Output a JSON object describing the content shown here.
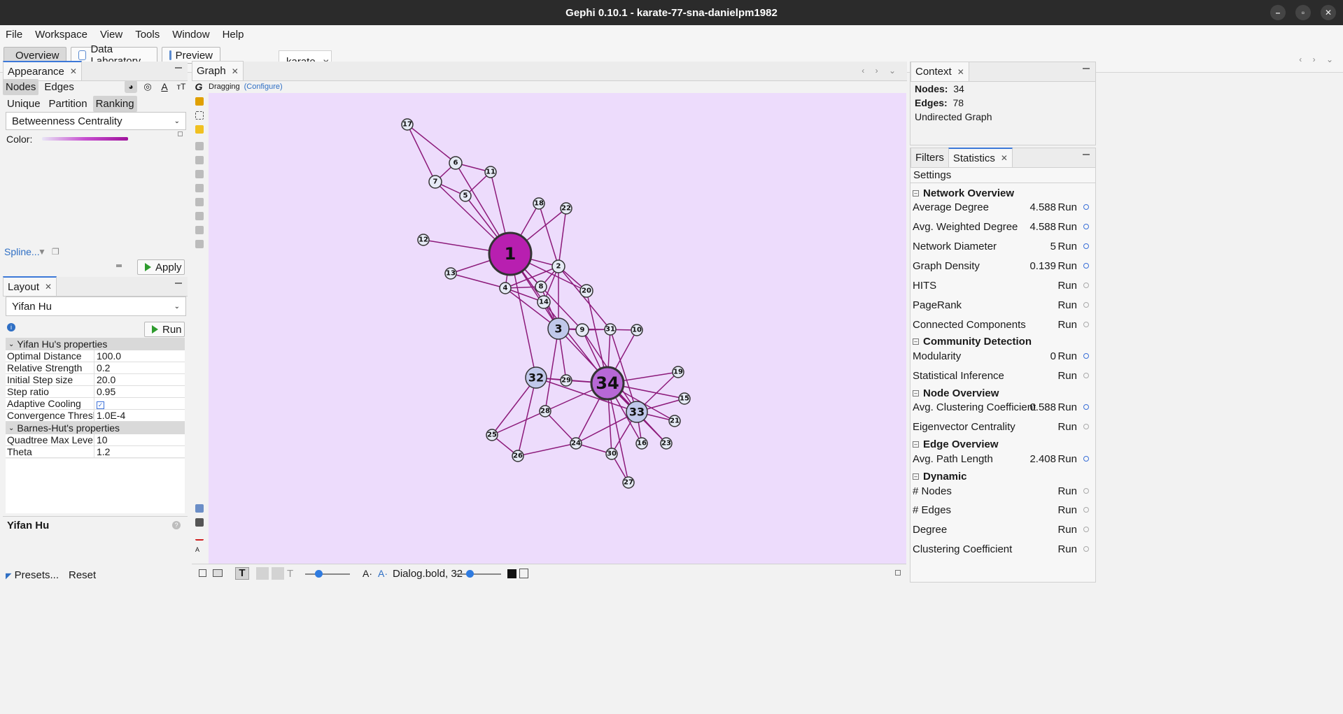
{
  "window": {
    "title": "Gephi 0.10.1 - karate-77-sna-danielpm1982"
  },
  "menu": [
    "File",
    "Workspace",
    "View",
    "Tools",
    "Window",
    "Help"
  ],
  "toolbar": {
    "overview": "Overview",
    "data_lab": "Data Laboratory",
    "preview": "Preview",
    "workspace_tab": "karate"
  },
  "appearance": {
    "tab": "Appearance",
    "nodes": "Nodes",
    "edges": "Edges",
    "unique": "Unique",
    "partition": "Partition",
    "ranking": "Ranking",
    "attribute": "Betweenness Centrality",
    "color_label": "Color:",
    "spline": "Spline...",
    "apply": "Apply"
  },
  "layout": {
    "tab": "Layout",
    "algorithm": "Yifan Hu",
    "run": "Run",
    "section1": "Yifan Hu's properties",
    "props1": [
      {
        "k": "Optimal Distance",
        "v": "100.0"
      },
      {
        "k": "Relative Strength",
        "v": "0.2"
      },
      {
        "k": "Initial Step size",
        "v": "20.0"
      },
      {
        "k": "Step ratio",
        "v": "0.95"
      },
      {
        "k": "Adaptive Cooling",
        "v": ""
      },
      {
        "k": "Convergence Threshold",
        "v": "1.0E-4"
      }
    ],
    "section2": "Barnes-Hut's properties",
    "props2": [
      {
        "k": "Quadtree Max Level",
        "v": "10"
      },
      {
        "k": "Theta",
        "v": "1.2"
      }
    ],
    "description_title": "Yifan Hu",
    "presets": "Presets...",
    "reset": "Reset"
  },
  "graph": {
    "tab": "Graph",
    "mode": "Dragging",
    "configure": "(Configure)",
    "font_label": "Dialog.bold, 32",
    "node_color": "#b01fa8",
    "edge_color": "#8c1a7a",
    "background": "#eddcfc"
  },
  "context": {
    "tab": "Context",
    "nodes_label": "Nodes:",
    "nodes_value": "34",
    "edges_label": "Edges:",
    "edges_value": "78",
    "type": "Undirected Graph"
  },
  "stats_panel": {
    "filters_tab": "Filters",
    "statistics_tab": "Statistics",
    "settings": "Settings",
    "sections": {
      "network": "Network Overview",
      "community": "Community Detection",
      "node": "Node Overview",
      "edge": "Edge Overview",
      "dynamic": "Dynamic"
    },
    "run_label": "Run",
    "rows": {
      "avg_degree": {
        "name": "Average Degree",
        "value": "4.588"
      },
      "avg_weighted": {
        "name": "Avg. Weighted Degree",
        "value": "4.588"
      },
      "diameter": {
        "name": "Network Diameter",
        "value": "5"
      },
      "density": {
        "name": "Graph Density",
        "value": "0.139"
      },
      "hits": {
        "name": "HITS",
        "value": ""
      },
      "pagerank": {
        "name": "PageRank",
        "value": ""
      },
      "components": {
        "name": "Connected Components",
        "value": ""
      },
      "modularity": {
        "name": "Modularity",
        "value": "0"
      },
      "stat_inference": {
        "name": "Statistical Inference",
        "value": ""
      },
      "clustering": {
        "name": "Avg. Clustering Coefficient",
        "value": "0.588"
      },
      "eigenvector": {
        "name": "Eigenvector Centrality",
        "value": ""
      },
      "path_length": {
        "name": "Avg. Path Length",
        "value": "2.408"
      },
      "dyn_nodes": {
        "name": "# Nodes",
        "value": ""
      },
      "dyn_edges": {
        "name": "# Edges",
        "value": ""
      },
      "dyn_degree": {
        "name": "Degree",
        "value": ""
      },
      "dyn_clustering": {
        "name": "Clustering Coefficient",
        "value": ""
      }
    }
  }
}
